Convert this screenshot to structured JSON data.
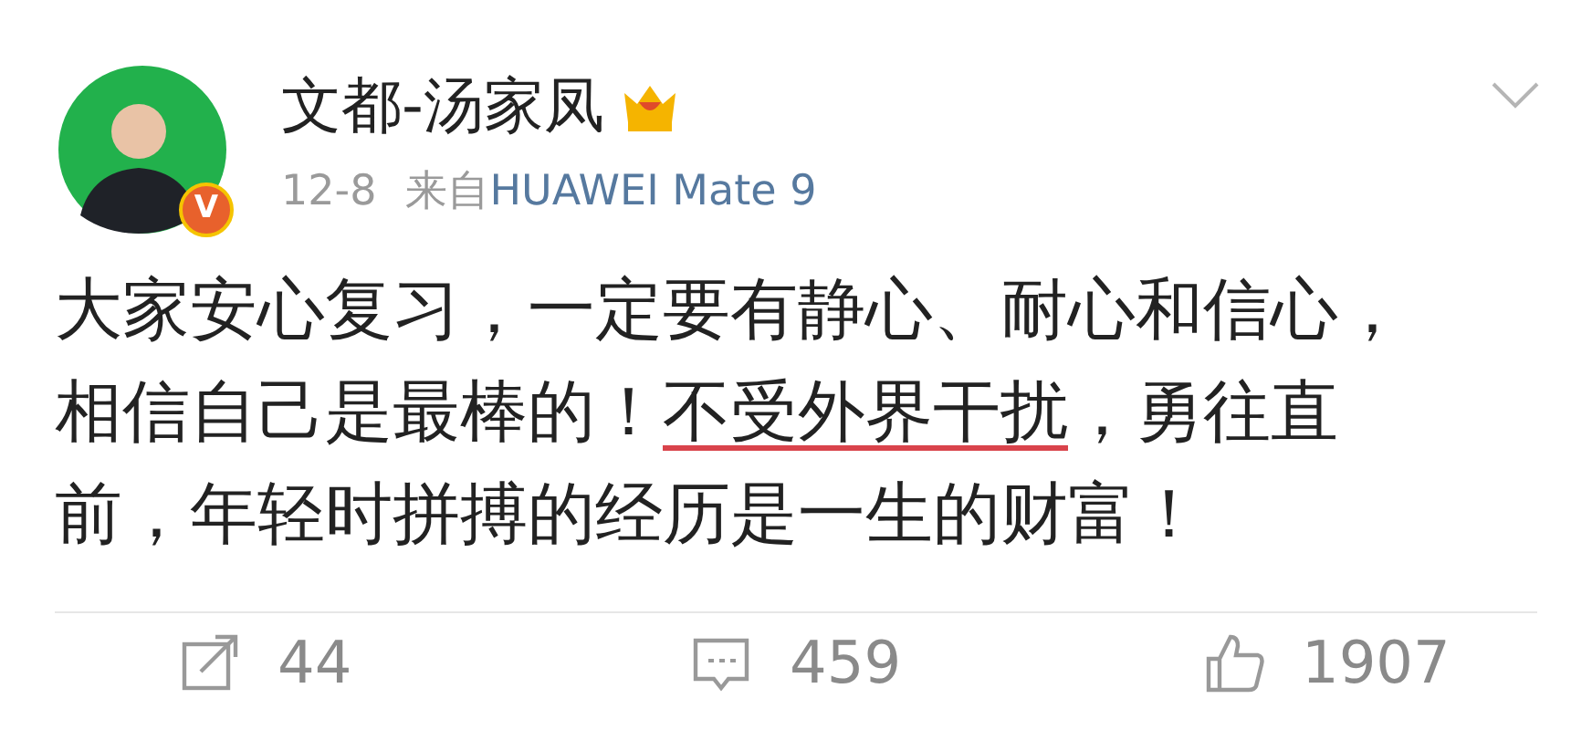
{
  "post": {
    "author": "文都-汤家凤",
    "date": "12-8",
    "source_prefix": "来自",
    "source": "HUAWEI Mate 9",
    "verified": true,
    "verified_badge": "V",
    "body_lines": [
      [
        {
          "text": "大家安心复习，一定要有静心、耐心和信心，",
          "marked": false
        }
      ],
      [
        {
          "text": "相信自己是最棒的！",
          "marked": false
        },
        {
          "text": "不受外界干扰",
          "marked": true
        },
        {
          "text": "，勇往直",
          "marked": false
        }
      ],
      [
        {
          "text": "前，年轻时拼搏的经历是一生的财富！",
          "marked": false
        }
      ]
    ],
    "actions": [
      {
        "kind": "repost",
        "count": "44"
      },
      {
        "kind": "comment",
        "count": "459"
      },
      {
        "kind": "like",
        "count": "1907"
      }
    ]
  }
}
